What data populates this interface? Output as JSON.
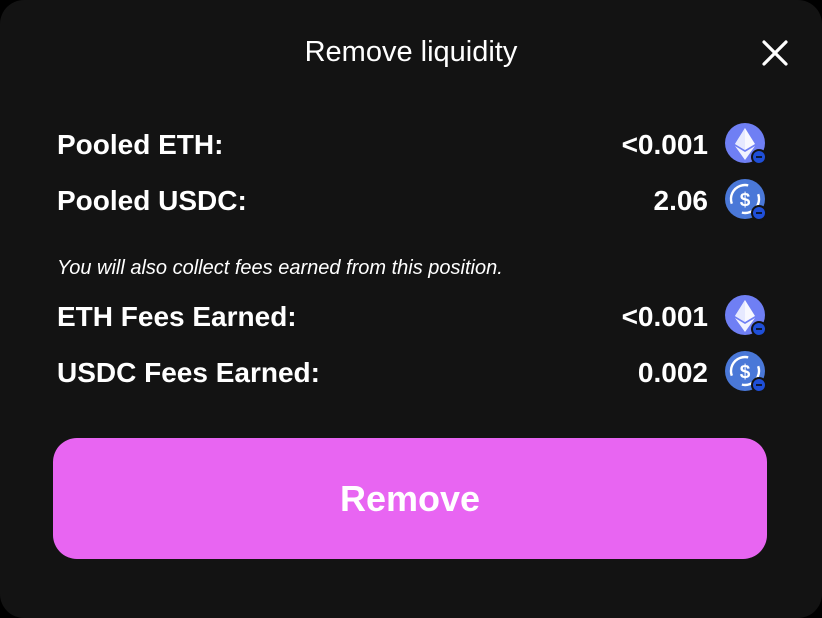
{
  "modal": {
    "title": "Remove liquidity",
    "close_icon": "close-icon"
  },
  "positions": [
    {
      "label": "Pooled ETH:",
      "value": "<0.001",
      "token_icon": "eth-icon"
    },
    {
      "label": "Pooled USDC:",
      "value": "2.06",
      "token_icon": "usdc-icon"
    }
  ],
  "fees_note": "You will also collect fees earned from this position.",
  "fees": [
    {
      "label": "ETH Fees Earned:",
      "value": "<0.001",
      "token_icon": "eth-icon"
    },
    {
      "label": "USDC Fees Earned:",
      "value": "0.002",
      "token_icon": "usdc-icon"
    }
  ],
  "remove_button_label": "Remove",
  "colors": {
    "background": "#131313",
    "accent": "#e865f2",
    "token_icon_bg": "#6f7ff4",
    "network_badge": "#1f4fd8"
  }
}
